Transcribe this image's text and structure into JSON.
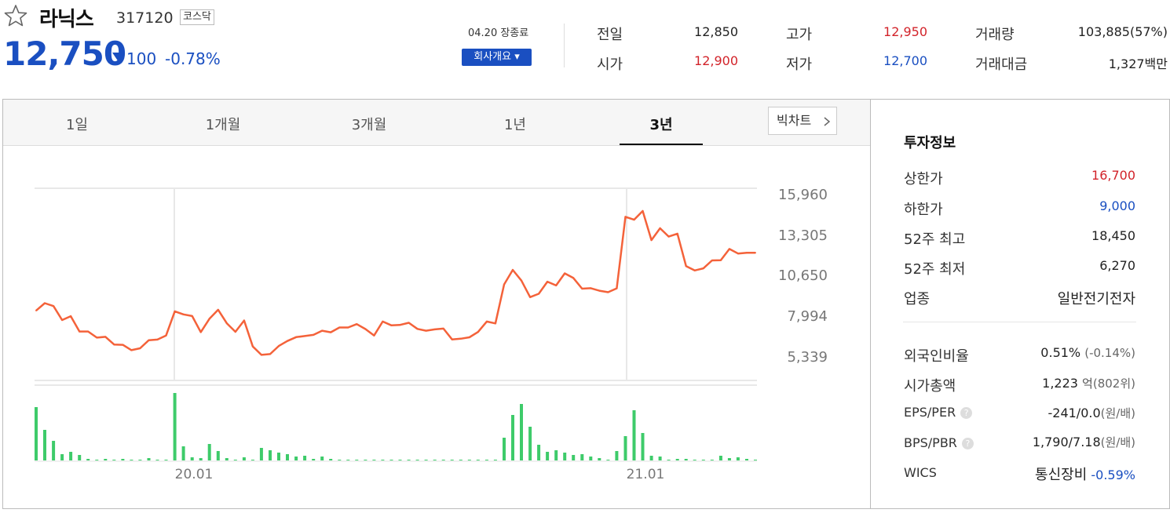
{
  "header": {
    "name": "라닉스",
    "code": "317120",
    "market": "코스닥",
    "price": "12,750",
    "change": "100",
    "change_pct": "-0.78%",
    "date_status": "04.20 장종료",
    "overview_label": "회사개요 ▾"
  },
  "quote": {
    "prev_label": "전일",
    "prev": "12,850",
    "open_label": "시가",
    "open": "12,900",
    "high_label": "고가",
    "high": "12,950",
    "low_label": "저가",
    "low": "12,700",
    "volume_label": "거래량",
    "volume": "103,885(57%)",
    "amount_label": "거래대금",
    "amount": "1,327백만"
  },
  "tabs": [
    "1일",
    "1개월",
    "3개월",
    "1년",
    "3년"
  ],
  "active_tab": "3년",
  "big_chart_label": "빅차트",
  "invest": {
    "title": "투자정보",
    "upper_label": "상한가",
    "upper": "16,700",
    "lower_label": "하한가",
    "lower": "9,000",
    "high52_label": "52주 최고",
    "high52": "18,450",
    "low52_label": "52주 최저",
    "low52": "6,270",
    "sector_label": "업종",
    "sector": "일반전기전자",
    "foreign_label": "외국인비율",
    "foreign": "0.51%",
    "foreign_chg": "(-0.14%)",
    "mcap_label": "시가총액",
    "mcap": "1,223",
    "mcap_unit": "억",
    "mcap_rank": "(802위)",
    "eps_label": "EPS/PER",
    "eps": "-241/0.0",
    "eps_unit": "(원/배)",
    "bps_label": "BPS/PBR",
    "bps": "1,790/7.18",
    "bps_unit": "(원/배)",
    "wics_label": "WICS",
    "wics": "통신장비",
    "wics_chg": "-0.59%"
  },
  "colors": {
    "up": "#d2232a",
    "down": "#1a4fc1",
    "line": "#f4623a",
    "volume": "#3ecb6a"
  },
  "chart_data": {
    "type": "line",
    "y_ticks": [
      "15,960",
      "13,305",
      "10,650",
      "7,994",
      "5,339"
    ],
    "x_ticks": [
      "20.01",
      "21.01"
    ],
    "ylim": [
      5339,
      15960
    ],
    "price_series": [
      8320,
      8800,
      8610,
      7700,
      7950,
      6950,
      6950,
      6550,
      6600,
      6100,
      6080,
      5730,
      5850,
      6380,
      6420,
      6690,
      8270,
      8070,
      7960,
      6910,
      7780,
      8370,
      7490,
      6930,
      7670,
      5970,
      5420,
      5470,
      6000,
      6330,
      6580,
      6650,
      6730,
      7000,
      6900,
      7210,
      7210,
      7430,
      7110,
      6690,
      7600,
      7350,
      7380,
      7520,
      7120,
      7000,
      7090,
      7140,
      6430,
      6480,
      6570,
      6920,
      7600,
      7480,
      10030,
      10980,
      10280,
      9200,
      9420,
      10210,
      9960,
      10750,
      10450,
      9750,
      9780,
      9620,
      9520,
      9770,
      14450,
      14260,
      14830,
      12930,
      13700,
      13160,
      13350,
      11230,
      10940,
      11080,
      11600,
      11610,
      12350,
      12050,
      12100,
      12100
    ],
    "volume_series": [
      68,
      39,
      25,
      8,
      11,
      7,
      2,
      0,
      2,
      0,
      2,
      0,
      0,
      3,
      0,
      0,
      86,
      18,
      4,
      3,
      21,
      12,
      3,
      0,
      4,
      0,
      16,
      13,
      10,
      8,
      5,
      6,
      2,
      5,
      2,
      0,
      0,
      0,
      0,
      0,
      0,
      0,
      0,
      0,
      0,
      0,
      0,
      0,
      0,
      0,
      0,
      0,
      0,
      0,
      29,
      58,
      72,
      43,
      20,
      11,
      13,
      10,
      7,
      8,
      5,
      3,
      0,
      12,
      31,
      64,
      35,
      6,
      5,
      0,
      2,
      2,
      0,
      0,
      0,
      6,
      3,
      4,
      2,
      0
    ]
  }
}
